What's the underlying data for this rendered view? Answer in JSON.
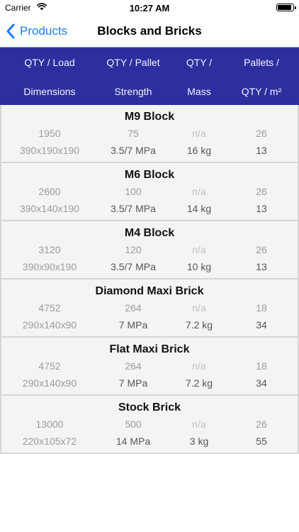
{
  "status": {
    "carrier": "Carrier",
    "time": "10:27 AM",
    "battery_level": 0.9
  },
  "nav": {
    "back_label": "Products",
    "title": "Blocks and Bricks"
  },
  "header": {
    "row1": [
      "QTY / Load",
      "QTY / Pallet",
      "QTY /",
      "Pallets /"
    ],
    "row2": [
      "Dimensions",
      "Strength",
      "Mass",
      "QTY / m²"
    ]
  },
  "products": [
    {
      "name": "M9 Block",
      "qty_load": "1950",
      "qty_pallet": "75",
      "qty": "n/a",
      "pallets": "26",
      "dimensions": "390x190x190",
      "strength": "3.5/7 MPa",
      "mass": "16 kg",
      "qty_m2": "13"
    },
    {
      "name": "M6 Block",
      "qty_load": "2600",
      "qty_pallet": "100",
      "qty": "n/a",
      "pallets": "26",
      "dimensions": "390x140x190",
      "strength": "3.5/7 MPa",
      "mass": "14 kg",
      "qty_m2": "13"
    },
    {
      "name": "M4 Block",
      "qty_load": "3120",
      "qty_pallet": "120",
      "qty": "n/a",
      "pallets": "26",
      "dimensions": "390x90x190",
      "strength": "3.5/7 MPa",
      "mass": "10 kg",
      "qty_m2": "13"
    },
    {
      "name": "Diamond Maxi Brick",
      "qty_load": "4752",
      "qty_pallet": "264",
      "qty": "n/a",
      "pallets": "18",
      "dimensions": "290x140x90",
      "strength": "7 MPa",
      "mass": "7.2 kg",
      "qty_m2": "34"
    },
    {
      "name": "Flat Maxi Brick",
      "qty_load": "4752",
      "qty_pallet": "264",
      "qty": "n/a",
      "pallets": "18",
      "dimensions": "290x140x90",
      "strength": "7 MPa",
      "mass": "7.2 kg",
      "qty_m2": "34"
    },
    {
      "name": "Stock Brick",
      "qty_load": "13000",
      "qty_pallet": "500",
      "qty": "n/a",
      "pallets": "26",
      "dimensions": "220x105x72",
      "strength": "14 MPa",
      "mass": "3 kg",
      "qty_m2": "55"
    }
  ],
  "colors": {
    "accent": "#1a7bf5",
    "header_bg": "#2e2f9e"
  }
}
